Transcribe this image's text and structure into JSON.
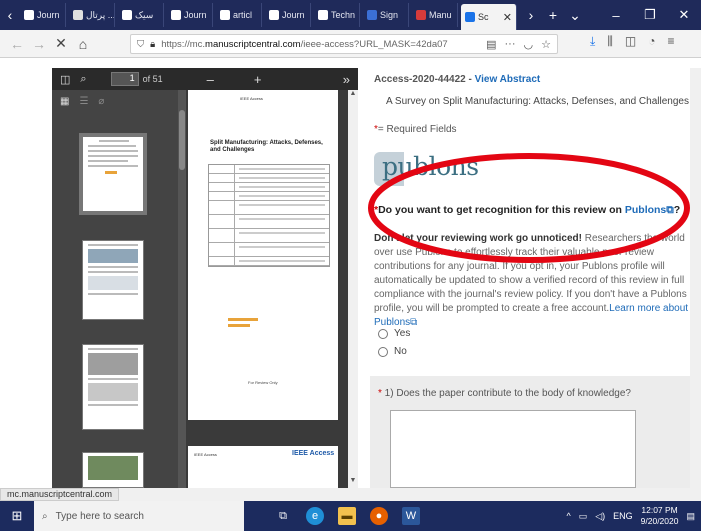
{
  "tabs": [
    {
      "label": "Journ",
      "icon": "page-icon",
      "color": "#ffffff"
    },
    {
      "label": "پرتال ...",
      "icon": "page-icon",
      "color": "#e0e0e0"
    },
    {
      "label": "سیک",
      "icon": "page-icon",
      "color": "#ffffff"
    },
    {
      "label": "Journ",
      "icon": "globe-icon",
      "color": "#ffffff"
    },
    {
      "label": "articl",
      "icon": "globe-icon",
      "color": "#ffffff"
    },
    {
      "label": "Journ",
      "icon": "globe-icon",
      "color": "#ffffff"
    },
    {
      "label": "Techn",
      "icon": "globe-icon",
      "color": "#ffffff"
    },
    {
      "label": "Sign",
      "icon": "publons-tab-icon",
      "color": "#3b6fd4"
    },
    {
      "label": "Manu",
      "icon": "mail-icon",
      "color": "#d63b3b"
    },
    {
      "label": "Sc",
      "icon": "loading-icon",
      "color": "#1a73e8",
      "active": true
    }
  ],
  "browser": {
    "url_prefix": "https://mc.",
    "url_domain": "manuscriptcentral.com",
    "url_suffix": "/ieee-access?URL_MASK=42da07",
    "status_url": "mc.manuscriptcentral.com"
  },
  "pdf": {
    "page_number": "1",
    "page_total": "of 51",
    "journal_label": "IEEE Access",
    "title_text": "Split Manufacturing: Attacks, Defenses, and Challenges",
    "footer_label": "For Review Only",
    "page2_journal": "IEEE Access",
    "page2_logo": "IEEE Access"
  },
  "form": {
    "manuscript_id": "Access-2020-44422",
    "separator": " - ",
    "view_abstract": "View Abstract",
    "paper_title": "A Survey on Split Manufacturing: Attacks, Defenses, and Challenges",
    "required_star": "*",
    "required_text": "= Required Fields",
    "publons_logo": "publons",
    "publons_question_star": "*",
    "publons_question": "Do you want to get recognition for this review on ",
    "publons_link": "Publons",
    "publons_question_end": "?",
    "desc_bold": "Don't let your reviewing work go unnoticed!",
    "desc_text": " Researchers the world over use Publons to effortlessly track their valuable peer review contributions for any journal. If you opt in, your Publons profile will automatically be updated to show a verified record of this review in full compliance with the journal's review policy. If you don't have a Publons profile, you will be prompted to create a free account.",
    "learn_more": "Learn more about Publons",
    "options": [
      "Yes",
      "No"
    ],
    "q1_star": "*",
    "q1_text": " 1) Does the paper contribute to the body of knowledge?"
  },
  "taskbar": {
    "search_placeholder": "Type here to search",
    "language": "ENG",
    "time": "12:07 PM",
    "date": "9/20/2020"
  },
  "colors": {
    "annotation": "#e30613",
    "link": "#1e6bb8",
    "required": "#cc0000"
  }
}
